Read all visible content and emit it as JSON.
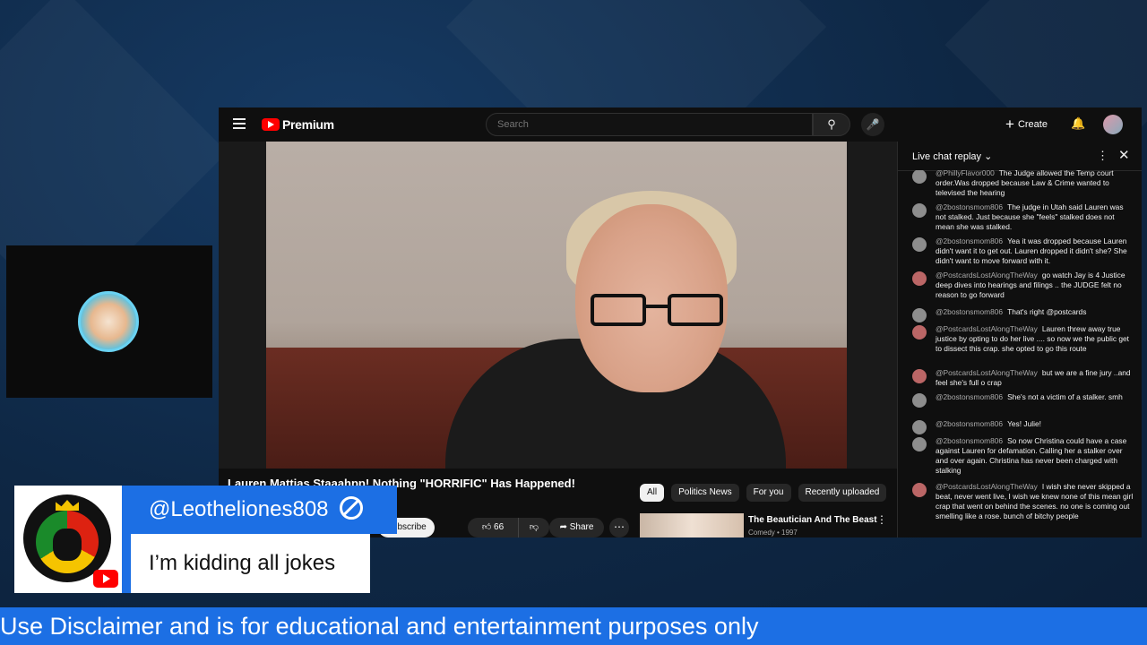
{
  "youtube": {
    "logo_text": "Premium",
    "search_placeholder": "Search",
    "create_label": "Create",
    "video_title": "Lauren Mattias Staaahpp! Nothing \"HORRIFIC\" Has Happened!",
    "subscribe_label": "Subscribe",
    "like_count": "66",
    "share_label": "Share",
    "chips": [
      "All",
      "Politics News",
      "For you",
      "Recently uploaded"
    ],
    "recommendation": {
      "title": "The Beautician And The Beast",
      "meta": "Comedy • 1997"
    }
  },
  "chat": {
    "title": "Live chat replay",
    "messages": [
      {
        "author": "@PhillyFlavor000",
        "text": "The Judge allowed the Temp court order.Was dropped because Law & Crime wanted to televised the hearing"
      },
      {
        "author": "@2bostonsmom806",
        "text": "The judge in Utah said Lauren was not stalked. Just because she \"feels\" stalked does not mean she was stalked."
      },
      {
        "author": "@2bostonsmom806",
        "text": "Yea it was dropped because Lauren didn't want it to get out. Lauren dropped it didn't she? She didn't want to move forward with it."
      },
      {
        "author": "@PostcardsLostAlongTheWay",
        "text": "go watch Jay is 4 Justice deep dives into hearings and filings .. the JUDGE felt no reason to go forward"
      },
      {
        "author": "@2bostonsmom806",
        "text": "That's right @postcards"
      },
      {
        "author": "@PostcardsLostAlongTheWay",
        "text": "Lauren threw away true justice by opting to do her live .... so now we the public get to dissect this crap. she opted to go this route"
      },
      {
        "author": "@PostcardsLostAlongTheWay",
        "text": "but we are a fine jury ..and feel she's full o crap"
      },
      {
        "author": "@2bostonsmom806",
        "text": "She's not a victim of a stalker. smh"
      },
      {
        "author": "@2bostonsmom806",
        "text": "Yes! Julie!"
      },
      {
        "author": "@2bostonsmom806",
        "text": "So now Christina could have a case against Lauren for defamation. Calling her a stalker over and over again. Christina has never been charged with stalking"
      },
      {
        "author": "@PostcardsLostAlongTheWay",
        "text": "I wish she never skipped a beat, never went live, I wish we knew none of this mean girl crap that went on behind the scenes. no one is coming out smelling like a rose. bunch of bitchy people"
      }
    ]
  },
  "overlay": {
    "comment_author": "@Leotheliones808",
    "comment_text": "I’m kidding all jokes",
    "ticker_text": "Use Disclaimer and is for educational and entertainment purposes only"
  },
  "colors": {
    "accent": "#1c6fe4",
    "yt_red": "#ff0000",
    "background": "#0e2744"
  },
  "icons": [
    "menu-icon",
    "youtube-logo-icon",
    "search-icon",
    "mic-icon",
    "plus-icon",
    "bell-icon",
    "like-icon",
    "dislike-icon",
    "share-icon",
    "more-icon",
    "close-icon",
    "chevron-down-icon",
    "ban-icon",
    "youtube-badge-icon"
  ]
}
